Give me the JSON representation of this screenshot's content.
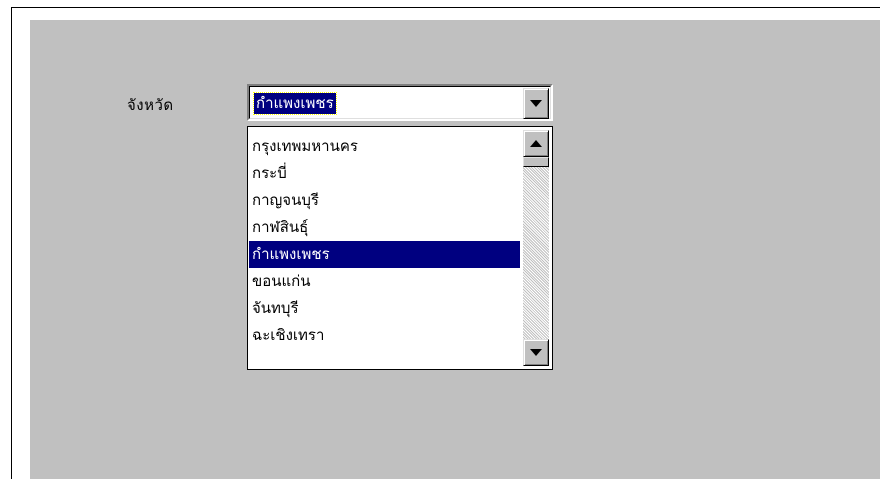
{
  "form": {
    "province_label": "จังหวัด"
  },
  "combobox": {
    "selected_value": "กำแพงเพชร",
    "dropdown_icon": "chevron-down-icon"
  },
  "listbox": {
    "items": [
      {
        "label": "กรุงเทพมหานคร",
        "selected": false
      },
      {
        "label": "กระบี่",
        "selected": false
      },
      {
        "label": "กาญจนบุรี",
        "selected": false
      },
      {
        "label": "กาฬสินธุ์",
        "selected": false
      },
      {
        "label": "กำแพงเพชร",
        "selected": true
      },
      {
        "label": "ขอนแก่น",
        "selected": false
      },
      {
        "label": "จันทบุรี",
        "selected": false
      },
      {
        "label": "ฉะเชิงเทรา",
        "selected": false
      }
    ],
    "scroll_position": 0,
    "scroll_up_icon": "scroll-up-arrow-icon",
    "scroll_down_icon": "scroll-down-arrow-icon"
  },
  "colors": {
    "panel_background": "#c0c0c0",
    "selection_background": "#000080",
    "selection_text": "#ffffff"
  }
}
